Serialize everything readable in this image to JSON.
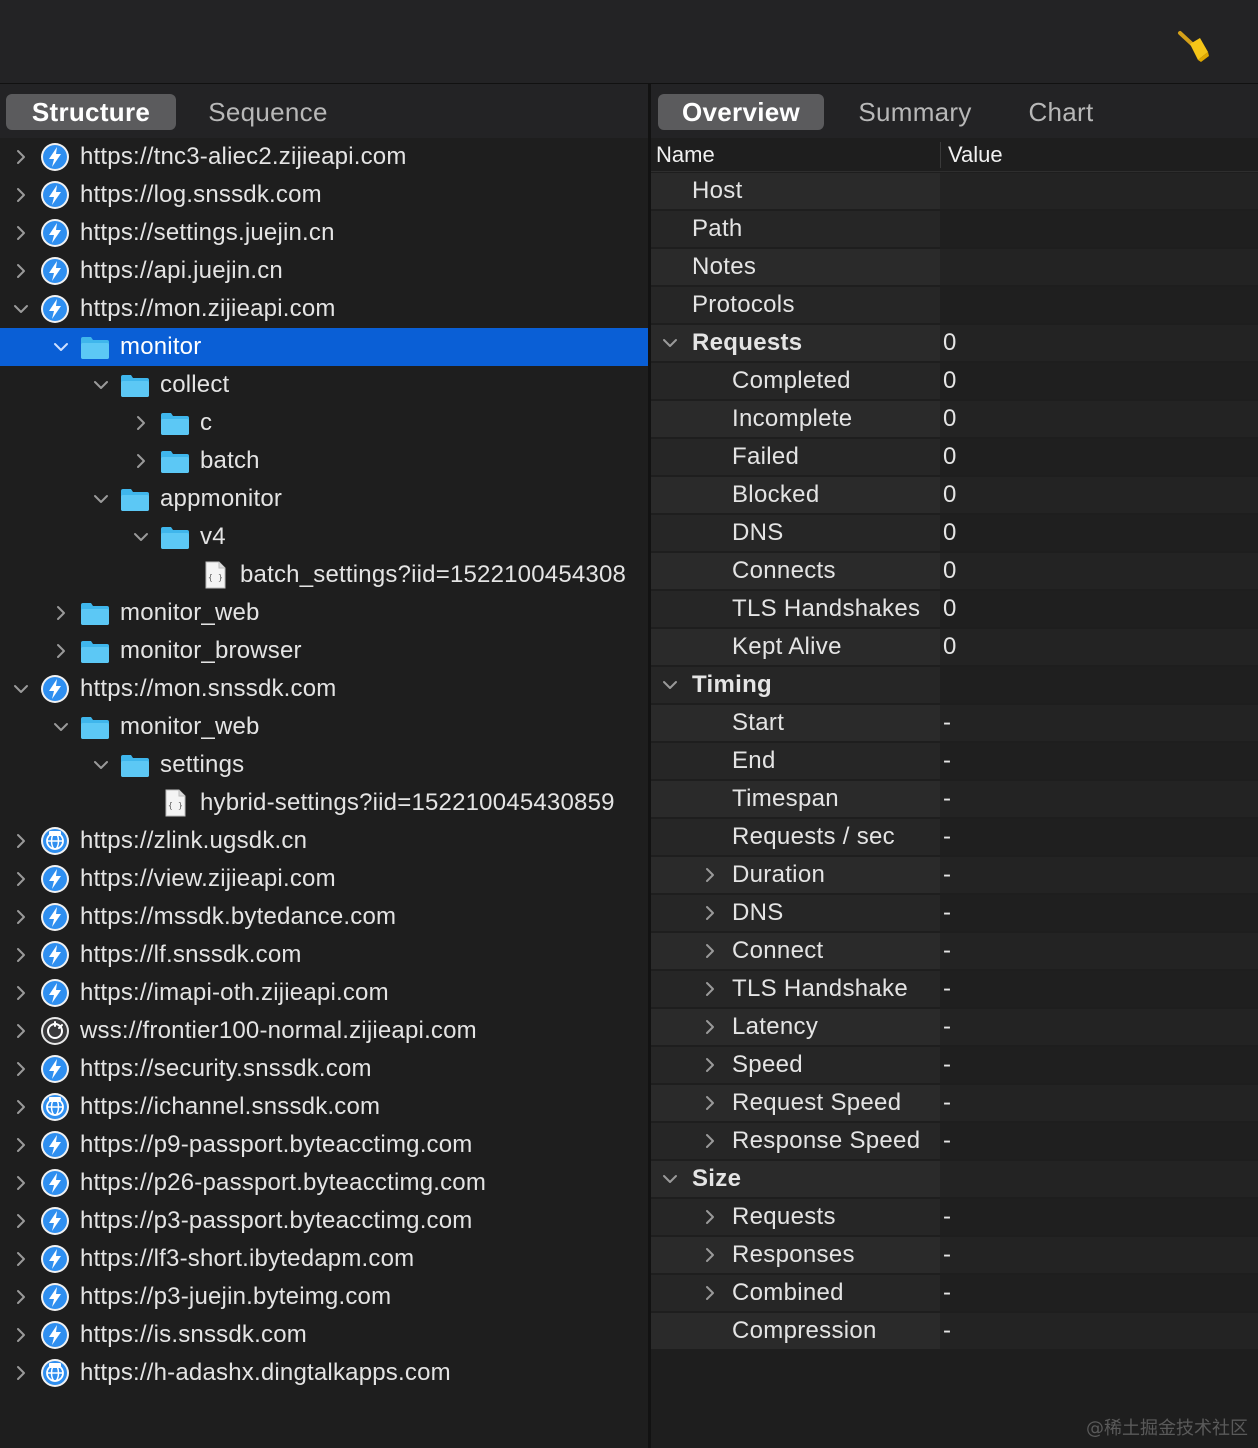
{
  "toolbar": {
    "clear_icon": "broom-icon"
  },
  "left_tabs": [
    "Structure",
    "Sequence"
  ],
  "right_tabs": [
    "Overview",
    "Summary",
    "Chart"
  ],
  "tree": [
    {
      "label": "https://tnc3-aliec2.zijieapi.com",
      "icon": "lightning",
      "level": 0,
      "chevron": "right"
    },
    {
      "label": "https://log.snssdk.com",
      "icon": "lightning",
      "level": 0,
      "chevron": "right"
    },
    {
      "label": "https://settings.juejin.cn",
      "icon": "lightning",
      "level": 0,
      "chevron": "right"
    },
    {
      "label": "https://api.juejin.cn",
      "icon": "lightning",
      "level": 0,
      "chevron": "right"
    },
    {
      "label": "https://mon.zijieapi.com",
      "icon": "lightning",
      "level": 0,
      "chevron": "down"
    },
    {
      "label": "monitor",
      "icon": "folder",
      "level": 1,
      "chevron": "down",
      "selected": true
    },
    {
      "label": "collect",
      "icon": "folder",
      "level": 2,
      "chevron": "down"
    },
    {
      "label": "c",
      "icon": "folder",
      "level": 3,
      "chevron": "right"
    },
    {
      "label": "batch",
      "icon": "folder",
      "level": 3,
      "chevron": "right"
    },
    {
      "label": "appmonitor",
      "icon": "folder",
      "level": 2,
      "chevron": "down"
    },
    {
      "label": "v4",
      "icon": "folder",
      "level": 3,
      "chevron": "down"
    },
    {
      "label": "batch_settings?iid=1522100454308",
      "icon": "json",
      "level": 4,
      "chevron": "none"
    },
    {
      "label": "monitor_web",
      "icon": "folder",
      "level": 1,
      "chevron": "right"
    },
    {
      "label": "monitor_browser",
      "icon": "folder",
      "level": 1,
      "chevron": "right"
    },
    {
      "label": "https://mon.snssdk.com",
      "icon": "lightning",
      "level": 0,
      "chevron": "down"
    },
    {
      "label": "monitor_web",
      "icon": "folder",
      "level": 1,
      "chevron": "down"
    },
    {
      "label": "settings",
      "icon": "folder",
      "level": 2,
      "chevron": "down"
    },
    {
      "label": "hybrid-settings?iid=152210045430859",
      "icon": "json",
      "level": 3,
      "chevron": "none"
    },
    {
      "label": "https://zlink.ugsdk.cn",
      "icon": "globe",
      "level": 0,
      "chevron": "right"
    },
    {
      "label": "https://view.zijieapi.com",
      "icon": "lightning",
      "level": 0,
      "chevron": "right"
    },
    {
      "label": "https://mssdk.bytedance.com",
      "icon": "lightning",
      "level": 0,
      "chevron": "right"
    },
    {
      "label": "https://lf.snssdk.com",
      "icon": "lightning",
      "level": 0,
      "chevron": "right"
    },
    {
      "label": "https://imapi-oth.zijieapi.com",
      "icon": "lightning",
      "level": 0,
      "chevron": "right"
    },
    {
      "label": "wss://frontier100-normal.zijieapi.com",
      "icon": "socket",
      "level": 0,
      "chevron": "right"
    },
    {
      "label": "https://security.snssdk.com",
      "icon": "lightning",
      "level": 0,
      "chevron": "right"
    },
    {
      "label": "https://ichannel.snssdk.com",
      "icon": "globe",
      "level": 0,
      "chevron": "right"
    },
    {
      "label": "https://p9-passport.byteacctimg.com",
      "icon": "lightning",
      "level": 0,
      "chevron": "right"
    },
    {
      "label": "https://p26-passport.byteacctimg.com",
      "icon": "lightning",
      "level": 0,
      "chevron": "right"
    },
    {
      "label": "https://p3-passport.byteacctimg.com",
      "icon": "lightning",
      "level": 0,
      "chevron": "right"
    },
    {
      "label": "https://lf3-short.ibytedapm.com",
      "icon": "lightning",
      "level": 0,
      "chevron": "right"
    },
    {
      "label": "https://p3-juejin.byteimg.com",
      "icon": "lightning",
      "level": 0,
      "chevron": "right"
    },
    {
      "label": "https://is.snssdk.com",
      "icon": "lightning",
      "level": 0,
      "chevron": "right"
    },
    {
      "label": "https://h-adashx.dingtalkapps.com",
      "icon": "globe",
      "level": 0,
      "chevron": "right"
    }
  ],
  "overview": {
    "header_name": "Name",
    "header_value": "Value",
    "rows": [
      {
        "name": "Host",
        "value": "",
        "level": 0,
        "chevron": "none"
      },
      {
        "name": "Path",
        "value": "",
        "level": 0,
        "chevron": "none"
      },
      {
        "name": "Notes",
        "value": "",
        "level": 0,
        "chevron": "none"
      },
      {
        "name": "Protocols",
        "value": "",
        "level": 0,
        "chevron": "none"
      },
      {
        "name": "Requests",
        "value": "0",
        "level": 0,
        "chevron": "down",
        "section": true
      },
      {
        "name": "Completed",
        "value": "0",
        "level": 1,
        "chevron": "none"
      },
      {
        "name": "Incomplete",
        "value": "0",
        "level": 1,
        "chevron": "none"
      },
      {
        "name": "Failed",
        "value": "0",
        "level": 1,
        "chevron": "none"
      },
      {
        "name": "Blocked",
        "value": "0",
        "level": 1,
        "chevron": "none"
      },
      {
        "name": "DNS",
        "value": "0",
        "level": 1,
        "chevron": "none"
      },
      {
        "name": "Connects",
        "value": "0",
        "level": 1,
        "chevron": "none"
      },
      {
        "name": "TLS Handshakes",
        "value": "0",
        "level": 1,
        "chevron": "none"
      },
      {
        "name": "Kept Alive",
        "value": "0",
        "level": 1,
        "chevron": "none"
      },
      {
        "name": "Timing",
        "value": "",
        "level": 0,
        "chevron": "down",
        "section": true
      },
      {
        "name": "Start",
        "value": "-",
        "level": 1,
        "chevron": "none"
      },
      {
        "name": "End",
        "value": "-",
        "level": 1,
        "chevron": "none"
      },
      {
        "name": "Timespan",
        "value": "-",
        "level": 1,
        "chevron": "none"
      },
      {
        "name": "Requests / sec",
        "value": "-",
        "level": 1,
        "chevron": "none"
      },
      {
        "name": "Duration",
        "value": "-",
        "level": 1,
        "chevron": "right"
      },
      {
        "name": "DNS",
        "value": "-",
        "level": 1,
        "chevron": "right"
      },
      {
        "name": "Connect",
        "value": "-",
        "level": 1,
        "chevron": "right"
      },
      {
        "name": "TLS Handshake",
        "value": "-",
        "level": 1,
        "chevron": "right"
      },
      {
        "name": "Latency",
        "value": "-",
        "level": 1,
        "chevron": "right"
      },
      {
        "name": "Speed",
        "value": "-",
        "level": 1,
        "chevron": "right"
      },
      {
        "name": "Request Speed",
        "value": "-",
        "level": 1,
        "chevron": "right"
      },
      {
        "name": "Response Speed",
        "value": "-",
        "level": 1,
        "chevron": "right"
      },
      {
        "name": "Size",
        "value": "",
        "level": 0,
        "chevron": "down",
        "section": true
      },
      {
        "name": "Requests",
        "value": "-",
        "level": 1,
        "chevron": "right"
      },
      {
        "name": "Responses",
        "value": "-",
        "level": 1,
        "chevron": "right"
      },
      {
        "name": "Combined",
        "value": "-",
        "level": 1,
        "chevron": "right"
      },
      {
        "name": "Compression",
        "value": "-",
        "level": 1,
        "chevron": "none"
      }
    ]
  },
  "watermark": "@稀土掘金技术社区",
  "colors": {
    "selection": "#0a5fd6",
    "folder": "#3fb6ec",
    "lightning_bg": "#2f8ff0",
    "broom": "#f5c518"
  }
}
